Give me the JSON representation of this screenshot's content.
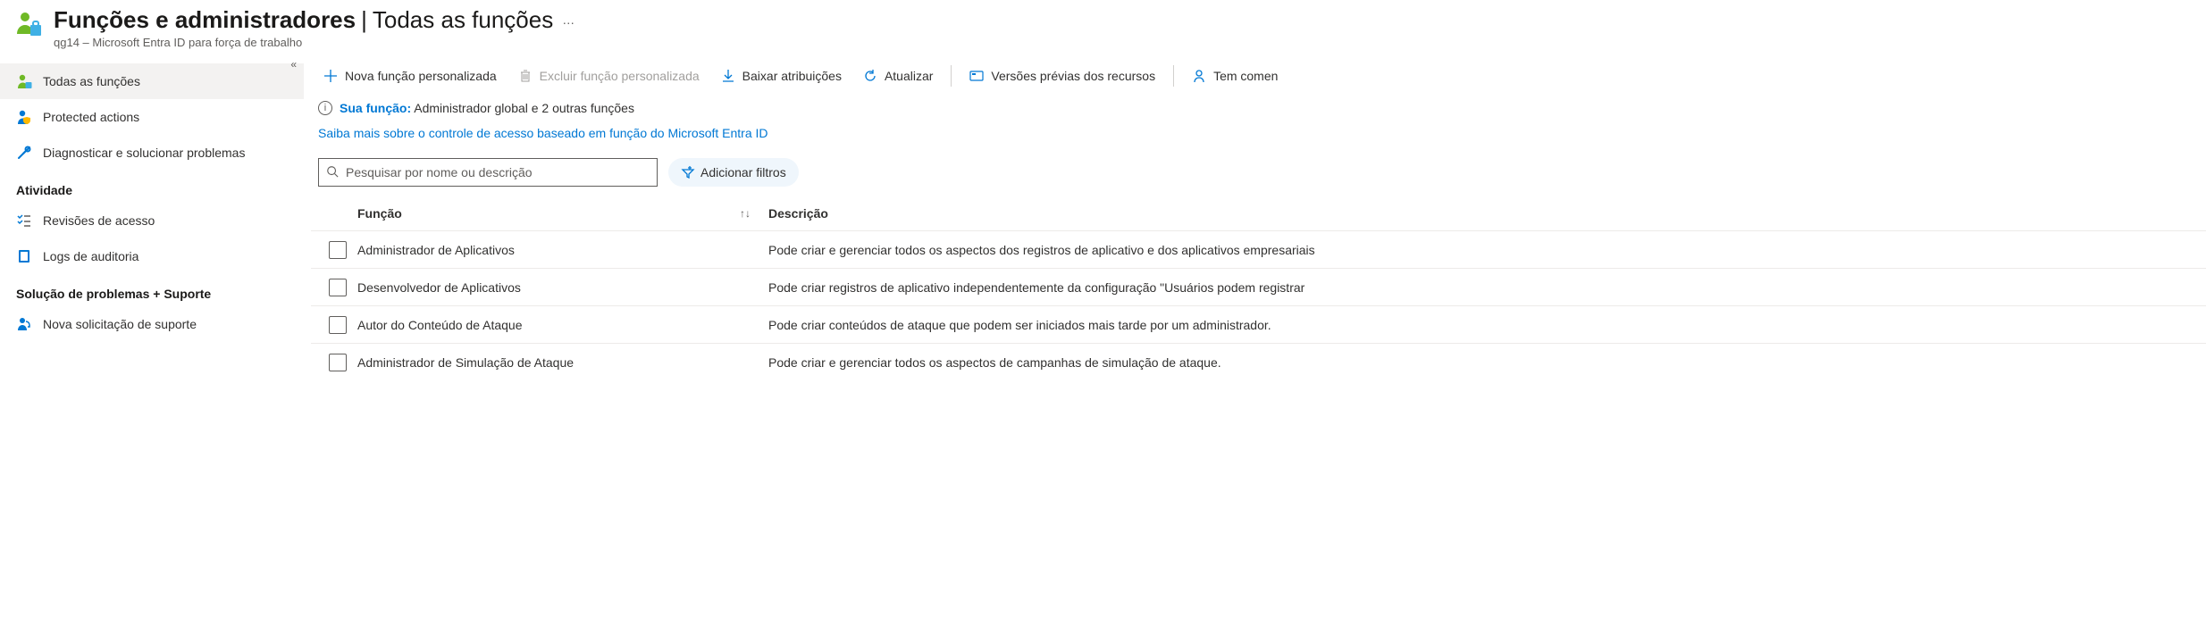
{
  "header": {
    "title_main": "Funções e administradores",
    "title_sub": "Todas as funções",
    "title_sep": "|",
    "subtitle": "qg14 – Microsoft Entra ID para força de trabalho",
    "more": "…"
  },
  "sidebar": {
    "items": [
      {
        "icon": "user-admin",
        "label": "Todas as funções",
        "selected": true
      },
      {
        "icon": "user-shield",
        "label": "Protected actions",
        "selected": false
      },
      {
        "icon": "wrench",
        "label": "Diagnosticar e solucionar problemas",
        "selected": false
      }
    ],
    "section_activity": "Atividade",
    "activity_items": [
      {
        "icon": "checklist",
        "label": "Revisões de acesso"
      },
      {
        "icon": "book",
        "label": "Logs de auditoria"
      }
    ],
    "section_support": "Solução de problemas + Suporte",
    "support_items": [
      {
        "icon": "headset",
        "label": "Nova solicitação de suporte"
      }
    ]
  },
  "cmdbar": {
    "new_role": "Nova função personalizada",
    "delete_role": "Excluir função personalizada",
    "download": "Baixar atribuições",
    "refresh": "Atualizar",
    "previews": "Versões prévias dos recursos",
    "feedback": "Tem comen"
  },
  "info": {
    "your_role_label": "Sua função:",
    "your_role_value": "Administrador global e 2 outras funções"
  },
  "rbac_link": "Saiba mais sobre o controle de acesso baseado em função do Microsoft Entra ID",
  "search": {
    "placeholder": "Pesquisar por nome ou descrição"
  },
  "filter_button": "Adicionar filtros",
  "table": {
    "col_role": "Função",
    "col_desc": "Descrição",
    "sort_glyph": "↑↓",
    "rows": [
      {
        "role": "Administrador de Aplicativos",
        "desc": "Pode criar e gerenciar todos os aspectos dos registros de aplicativo e dos aplicativos empresariais"
      },
      {
        "role": "Desenvolvedor de Aplicativos",
        "desc": "Pode criar registros de aplicativo independentemente da configuração \"Usuários podem registrar"
      },
      {
        "role": "Autor do Conteúdo de Ataque",
        "desc": "Pode criar conteúdos de ataque que podem ser iniciados mais tarde por um administrador."
      },
      {
        "role": "Administrador de Simulação de Ataque",
        "desc": "Pode criar e gerenciar todos os aspectos de campanhas de simulação de ataque."
      }
    ]
  }
}
